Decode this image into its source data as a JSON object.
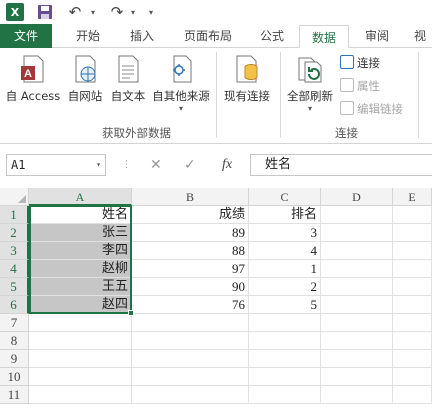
{
  "qat": {
    "logo_letter": "X",
    "undo_glyph": "↶",
    "redo_glyph": "↷",
    "dropdown_glyph": "▾"
  },
  "tabs": [
    {
      "label": "文件"
    },
    {
      "label": "开始"
    },
    {
      "label": "插入"
    },
    {
      "label": "页面布局"
    },
    {
      "label": "公式"
    },
    {
      "label": "数据",
      "active": true
    },
    {
      "label": "审阅"
    },
    {
      "label": "视"
    }
  ],
  "ribbon": {
    "get_external": {
      "buttons": [
        {
          "label": "自 Access",
          "icon": "access-icon"
        },
        {
          "label": "自网站",
          "icon": "web-icon"
        },
        {
          "label": "自文本",
          "icon": "text-file-icon"
        },
        {
          "label": "自其他来源",
          "icon": "other-sources-icon"
        }
      ],
      "group_label": "获取外部数据"
    },
    "existing_connections": {
      "label": "现有连接",
      "icon": "database-icon"
    },
    "connections": {
      "refresh_all": "全部刷新",
      "connections_label": "连接",
      "properties_label": "属性",
      "edit_links_label": "编辑链接",
      "group_label": "连接"
    }
  },
  "formula_bar": {
    "name_box": "A1",
    "cancel_glyph": "✕",
    "enter_glyph": "✓",
    "fx_label": "fx",
    "content": "姓名"
  },
  "columns": [
    "A",
    "B",
    "C",
    "D",
    "E"
  ],
  "rows": [
    "1",
    "2",
    "3",
    "4",
    "5",
    "6",
    "7",
    "8",
    "9",
    "10",
    "11"
  ],
  "cells": {
    "A1": "姓名",
    "B1": "成绩",
    "C1": "排名",
    "A2": "张三",
    "B2": "89",
    "C2": "3",
    "A3": "李四",
    "B3": "88",
    "C3": "4",
    "A4": "赵柳",
    "B4": "97",
    "C4": "1",
    "A5": "王五",
    "B5": "90",
    "C5": "2",
    "A6": "赵四",
    "B6": "76",
    "C6": "5"
  },
  "colors": {
    "accent": "#217346",
    "selection_fill": "#c6c6c6"
  }
}
